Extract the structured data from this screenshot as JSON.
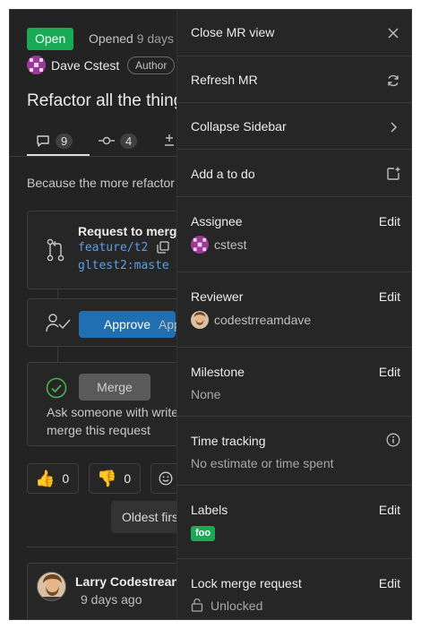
{
  "mr": {
    "status": "Open",
    "opened_prefix": "Opened",
    "opened_ago": "9 days",
    "author_name": "Dave Cstest",
    "author_badge": "Author",
    "title": "Refactor all the thing",
    "description": "Because the more refactor"
  },
  "tabs": [
    {
      "label": "9"
    },
    {
      "label": "4"
    }
  ],
  "widget": {
    "request_title": "Request to merg",
    "source_branch": "feature/t2",
    "target_branch": "gltest2:maste",
    "approve_label": "Approve",
    "approve_text": "App",
    "merge_label": "Merge",
    "merge_note_line1": "Ask someone with write",
    "merge_note_line2": "merge this request"
  },
  "reactions": [
    {
      "emoji": "👍",
      "count": "0"
    },
    {
      "emoji": "👎",
      "count": "0"
    }
  ],
  "sort": {
    "label": "Oldest firs"
  },
  "comment": {
    "author": "Larry Codestrean",
    "time": "9 days ago"
  },
  "sidebar": {
    "close_label": "Close MR view",
    "refresh_label": "Refresh MR",
    "collapse_label": "Collapse Sidebar",
    "todo_label": "Add a to do",
    "edit_label": "Edit",
    "assignee": {
      "title": "Assignee",
      "user": "cstest"
    },
    "reviewer": {
      "title": "Reviewer",
      "user": "codestrreamdave"
    },
    "milestone": {
      "title": "Milestone",
      "value": "None"
    },
    "time_tracking": {
      "title": "Time tracking",
      "value": "No estimate or time spent"
    },
    "labels": {
      "title": "Labels",
      "chip": "foo"
    },
    "lock": {
      "title": "Lock merge request",
      "value": "Unlocked"
    }
  },
  "colors": {
    "open_badge": "#1aaa55",
    "approve_button": "#1f6fb2",
    "branch_link": "#5c9fe6",
    "label_chip": "#1aaa55"
  }
}
